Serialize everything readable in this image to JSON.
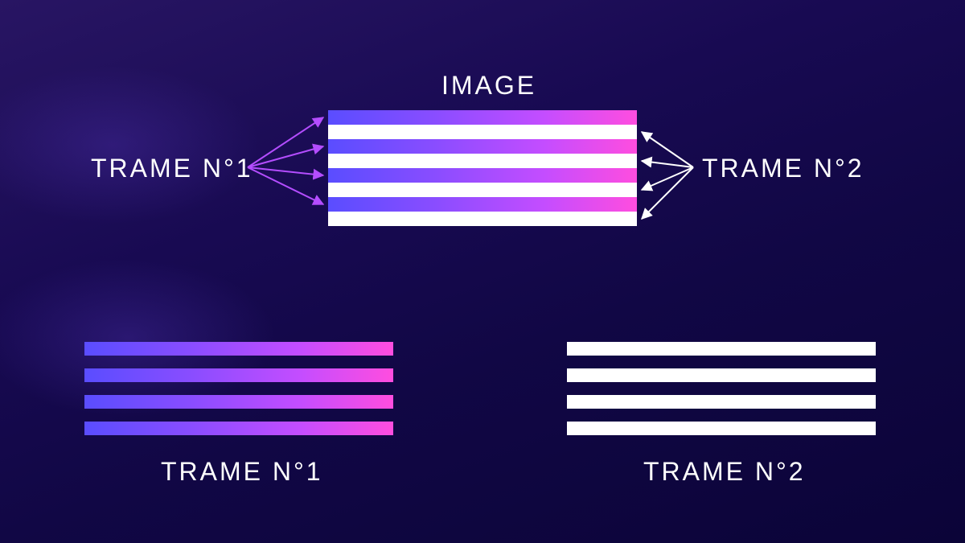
{
  "title": "IMAGE",
  "frame1_label": "TRAME N°1",
  "frame2_label": "TRAME N°2",
  "bottom_frame1_label": "TRAME N°1",
  "bottom_frame2_label": "TRAME N°2",
  "colors": {
    "gradient_start": "#5a4dff",
    "gradient_end": "#ff4ddf",
    "white": "#ffffff",
    "arrow_purple": "#b44dff"
  },
  "diagram": {
    "description": "Interlaced image composed of alternating scanlines from two frames (fields). Frame 1 supplies odd lines (gradient), Frame 2 supplies even lines (white).",
    "combined_rows": 8,
    "frame_lines": 4
  }
}
